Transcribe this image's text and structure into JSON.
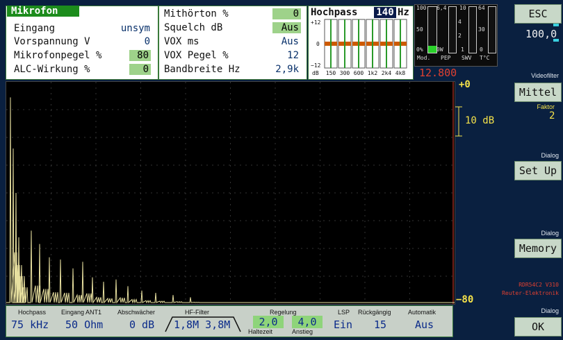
{
  "mic": {
    "title": "Mikrofon",
    "rows": [
      {
        "label": "Eingang",
        "value": "unsym"
      },
      {
        "label": "Vorspannung V",
        "value": "0"
      },
      {
        "label": "Mikrofonpegel %",
        "value": "80"
      },
      {
        "label": "ALC-Wirkung %",
        "value": "0"
      }
    ]
  },
  "mid": {
    "rows": [
      {
        "label": "Mithörton %",
        "value": "0"
      },
      {
        "label": "Squelch dB",
        "value": "Aus"
      },
      {
        "label": "VOX ms",
        "value": "Aus"
      },
      {
        "label": "VOX Pegel %",
        "value": "12"
      },
      {
        "label": "Bandbreite Hz",
        "value": "2,9k"
      }
    ]
  },
  "hp": {
    "title": "Hochpass",
    "value": "140",
    "unit": "Hz",
    "y_labels": [
      "+12",
      "0",
      "−12"
    ],
    "db_label": "dB",
    "bands": [
      "150",
      "300",
      "600",
      "1k2",
      "2k4",
      "4k8"
    ]
  },
  "meters": {
    "mod_scale": [
      "100",
      "50",
      "0%"
    ],
    "pep_scale": [
      "6,4",
      "0W"
    ],
    "swv_scale": [
      "10",
      "4",
      "2",
      "1"
    ],
    "temp_scale": [
      "64",
      "30",
      "0"
    ],
    "labels": [
      "Mod.",
      "PEP",
      "SWV",
      "T°C"
    ],
    "mod_level": 0.15
  },
  "freq": "12.800",
  "spectrum": {
    "top_label": "+0",
    "bottom_label": "−80",
    "scale_label": "10 dB"
  },
  "status": {
    "cols": [
      {
        "label": "Hochpass",
        "value": "75 kHz"
      },
      {
        "label": "Eingang ANT1",
        "value": "50 Ohm"
      },
      {
        "label": "Abschwächer",
        "value": "0 dB"
      },
      {
        "label": "HF-Filter",
        "value": "1,8M 3,8M"
      },
      {
        "label": "Regelung",
        "value": ""
      },
      {
        "label": "LSP",
        "value": "Ein"
      },
      {
        "label": "Rückgängig",
        "value": "15"
      },
      {
        "label": "Automatik",
        "value": "Aus"
      }
    ],
    "regelung_left": "2,0",
    "regelung_right": "4,0",
    "haltezeit": "Haltezeit",
    "anstieg": "Anstieg"
  },
  "side": {
    "esc": "ESC",
    "readout": "100,0",
    "videofilter_label": "Videofilter",
    "videofilter": "Mittel",
    "faktor_label": "Faktor",
    "faktor": "2",
    "dialog1": "Dialog",
    "setup": "Set Up",
    "dialog2": "Dialog",
    "memory": "Memory",
    "version": "RDR54C2 V310",
    "maker": "Reuter-Elektronik",
    "dialog3": "Dialog",
    "ok": "OK"
  },
  "colors": {
    "accent_green": "#1c8c1c",
    "value_box": "#9ed28a",
    "trace": "#e8e0a0",
    "yellow": "#f5e24a",
    "red": "#e04030"
  }
}
